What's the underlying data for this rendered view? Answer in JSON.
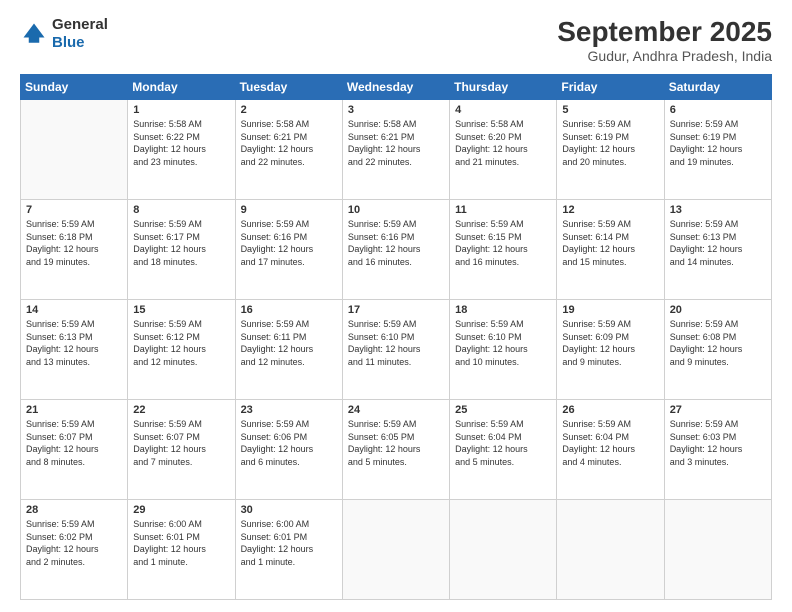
{
  "logo": {
    "general": "General",
    "blue": "Blue"
  },
  "header": {
    "month": "September 2025",
    "location": "Gudur, Andhra Pradesh, India"
  },
  "weekdays": [
    "Sunday",
    "Monday",
    "Tuesday",
    "Wednesday",
    "Thursday",
    "Friday",
    "Saturday"
  ],
  "weeks": [
    [
      {
        "day": "",
        "info": ""
      },
      {
        "day": "1",
        "info": "Sunrise: 5:58 AM\nSunset: 6:22 PM\nDaylight: 12 hours\nand 23 minutes."
      },
      {
        "day": "2",
        "info": "Sunrise: 5:58 AM\nSunset: 6:21 PM\nDaylight: 12 hours\nand 22 minutes."
      },
      {
        "day": "3",
        "info": "Sunrise: 5:58 AM\nSunset: 6:21 PM\nDaylight: 12 hours\nand 22 minutes."
      },
      {
        "day": "4",
        "info": "Sunrise: 5:58 AM\nSunset: 6:20 PM\nDaylight: 12 hours\nand 21 minutes."
      },
      {
        "day": "5",
        "info": "Sunrise: 5:59 AM\nSunset: 6:19 PM\nDaylight: 12 hours\nand 20 minutes."
      },
      {
        "day": "6",
        "info": "Sunrise: 5:59 AM\nSunset: 6:19 PM\nDaylight: 12 hours\nand 19 minutes."
      }
    ],
    [
      {
        "day": "7",
        "info": "Sunrise: 5:59 AM\nSunset: 6:18 PM\nDaylight: 12 hours\nand 19 minutes."
      },
      {
        "day": "8",
        "info": "Sunrise: 5:59 AM\nSunset: 6:17 PM\nDaylight: 12 hours\nand 18 minutes."
      },
      {
        "day": "9",
        "info": "Sunrise: 5:59 AM\nSunset: 6:16 PM\nDaylight: 12 hours\nand 17 minutes."
      },
      {
        "day": "10",
        "info": "Sunrise: 5:59 AM\nSunset: 6:16 PM\nDaylight: 12 hours\nand 16 minutes."
      },
      {
        "day": "11",
        "info": "Sunrise: 5:59 AM\nSunset: 6:15 PM\nDaylight: 12 hours\nand 16 minutes."
      },
      {
        "day": "12",
        "info": "Sunrise: 5:59 AM\nSunset: 6:14 PM\nDaylight: 12 hours\nand 15 minutes."
      },
      {
        "day": "13",
        "info": "Sunrise: 5:59 AM\nSunset: 6:13 PM\nDaylight: 12 hours\nand 14 minutes."
      }
    ],
    [
      {
        "day": "14",
        "info": "Sunrise: 5:59 AM\nSunset: 6:13 PM\nDaylight: 12 hours\nand 13 minutes."
      },
      {
        "day": "15",
        "info": "Sunrise: 5:59 AM\nSunset: 6:12 PM\nDaylight: 12 hours\nand 12 minutes."
      },
      {
        "day": "16",
        "info": "Sunrise: 5:59 AM\nSunset: 6:11 PM\nDaylight: 12 hours\nand 12 minutes."
      },
      {
        "day": "17",
        "info": "Sunrise: 5:59 AM\nSunset: 6:10 PM\nDaylight: 12 hours\nand 11 minutes."
      },
      {
        "day": "18",
        "info": "Sunrise: 5:59 AM\nSunset: 6:10 PM\nDaylight: 12 hours\nand 10 minutes."
      },
      {
        "day": "19",
        "info": "Sunrise: 5:59 AM\nSunset: 6:09 PM\nDaylight: 12 hours\nand 9 minutes."
      },
      {
        "day": "20",
        "info": "Sunrise: 5:59 AM\nSunset: 6:08 PM\nDaylight: 12 hours\nand 9 minutes."
      }
    ],
    [
      {
        "day": "21",
        "info": "Sunrise: 5:59 AM\nSunset: 6:07 PM\nDaylight: 12 hours\nand 8 minutes."
      },
      {
        "day": "22",
        "info": "Sunrise: 5:59 AM\nSunset: 6:07 PM\nDaylight: 12 hours\nand 7 minutes."
      },
      {
        "day": "23",
        "info": "Sunrise: 5:59 AM\nSunset: 6:06 PM\nDaylight: 12 hours\nand 6 minutes."
      },
      {
        "day": "24",
        "info": "Sunrise: 5:59 AM\nSunset: 6:05 PM\nDaylight: 12 hours\nand 5 minutes."
      },
      {
        "day": "25",
        "info": "Sunrise: 5:59 AM\nSunset: 6:04 PM\nDaylight: 12 hours\nand 5 minutes."
      },
      {
        "day": "26",
        "info": "Sunrise: 5:59 AM\nSunset: 6:04 PM\nDaylight: 12 hours\nand 4 minutes."
      },
      {
        "day": "27",
        "info": "Sunrise: 5:59 AM\nSunset: 6:03 PM\nDaylight: 12 hours\nand 3 minutes."
      }
    ],
    [
      {
        "day": "28",
        "info": "Sunrise: 5:59 AM\nSunset: 6:02 PM\nDaylight: 12 hours\nand 2 minutes."
      },
      {
        "day": "29",
        "info": "Sunrise: 6:00 AM\nSunset: 6:01 PM\nDaylight: 12 hours\nand 1 minute."
      },
      {
        "day": "30",
        "info": "Sunrise: 6:00 AM\nSunset: 6:01 PM\nDaylight: 12 hours\nand 1 minute."
      },
      {
        "day": "",
        "info": ""
      },
      {
        "day": "",
        "info": ""
      },
      {
        "day": "",
        "info": ""
      },
      {
        "day": "",
        "info": ""
      }
    ]
  ]
}
